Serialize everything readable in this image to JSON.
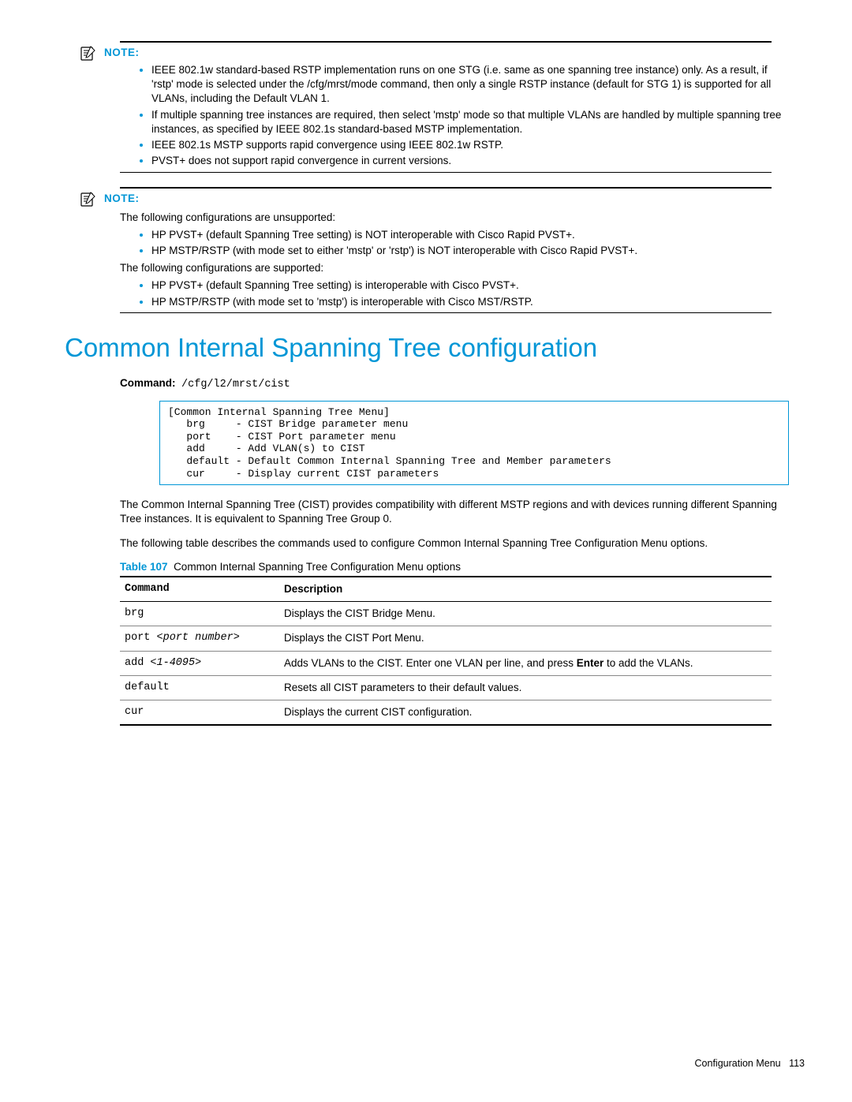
{
  "note1": {
    "label": "NOTE:",
    "items": [
      "IEEE 802.1w standard-based RSTP implementation runs on one STG (i.e. same as one spanning tree instance) only.  As a result, if 'rstp' mode is selected under the /cfg/mrst/mode command, then only a single RSTP instance (default for STG 1) is supported for all VLANs, including the Default VLAN 1.",
      "If multiple spanning tree instances are required, then select 'mstp' mode so that multiple VLANs are handled by multiple spanning tree instances, as specified by IEEE 802.1s standard-based MSTP implementation.",
      "IEEE 802.1s MSTP supports rapid convergence using IEEE 802.1w RSTP.",
      "PVST+ does not support rapid convergence in current versions."
    ]
  },
  "note2": {
    "label": "NOTE:",
    "intro1": "The following configurations are unsupported:",
    "items1": [
      "HP PVST+ (default Spanning Tree setting) is NOT interoperable with Cisco Rapid PVST+.",
      "HP MSTP/RSTP (with mode set to either 'mstp' or 'rstp') is NOT interoperable with Cisco Rapid PVST+."
    ],
    "intro2": "The following configurations are supported:",
    "items2": [
      "HP PVST+ (default Spanning Tree setting) is interoperable with Cisco PVST+.",
      "HP MSTP/RSTP (with mode set to 'mstp') is interoperable with Cisco MST/RSTP."
    ]
  },
  "heading": "Common Internal Spanning Tree configuration",
  "command_label": "Command:",
  "command_value": "/cfg/l2/mrst/cist",
  "codebox": "[Common Internal Spanning Tree Menu]\n   brg     - CIST Bridge parameter menu\n   port    - CIST Port parameter menu\n   add     - Add VLAN(s) to CIST\n   default - Default Common Internal Spanning Tree and Member parameters\n   cur     - Display current CIST parameters",
  "para1": "The Common Internal Spanning Tree (CIST) provides compatibility with different MSTP regions and with devices running different Spanning Tree instances. It is equivalent to Spanning Tree Group 0.",
  "para2": "The following table describes the commands used to configure Common Internal Spanning Tree Configuration Menu options.",
  "table_caption_label": "Table 107",
  "table_caption_text": "Common Internal Spanning Tree Configuration Menu options",
  "table": {
    "head": [
      "Command",
      "Description"
    ],
    "rows": [
      {
        "cmd": "brg",
        "desc": "Displays the CIST Bridge Menu."
      },
      {
        "cmd_prefix": "port ",
        "cmd_italic": "<port number>",
        "desc": "Displays the CIST Port Menu."
      },
      {
        "cmd_prefix": "add ",
        "cmd_italic": "<1-4095>",
        "desc_pre": "Adds VLANs to the CIST. Enter one VLAN per line, and press ",
        "desc_bold": "Enter",
        "desc_post": " to add the VLANs."
      },
      {
        "cmd": "default",
        "desc": "Resets all CIST parameters to their default values."
      },
      {
        "cmd": "cur",
        "desc": "Displays the current CIST configuration."
      }
    ]
  },
  "footer_section": "Configuration Menu",
  "footer_page": "113"
}
